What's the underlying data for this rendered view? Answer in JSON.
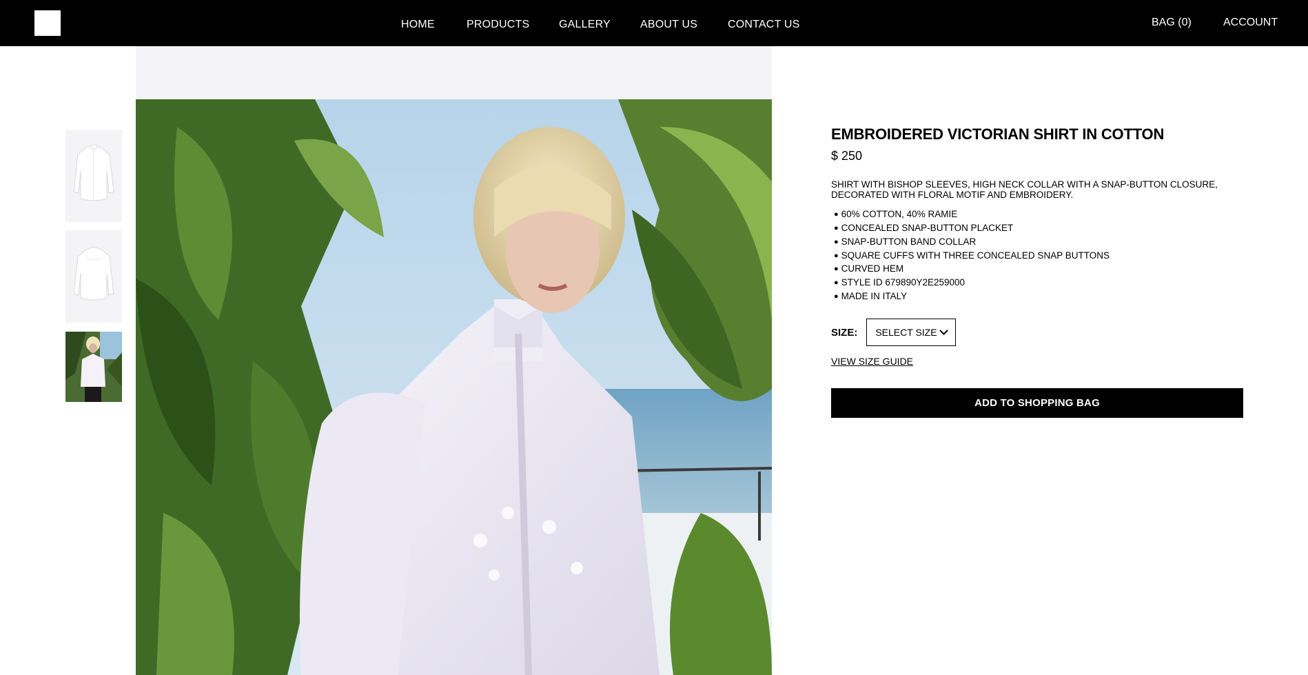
{
  "nav": {
    "links": [
      "HOME",
      "PRODUCTS",
      "GALLERY",
      "ABOUT US",
      "CONTACT US"
    ],
    "bag": "BAG (0)",
    "account": "ACCOUNT"
  },
  "product": {
    "title": "EMBROIDERED VICTORIAN SHIRT IN COTTON",
    "price": "$ 250",
    "description": "SHIRT WITH BISHOP SLEEVES, HIGH NECK COLLAR WITH A SNAP-BUTTON CLOSURE, DECORATED WITH FLORAL MOTIF AND EMBROIDERY.",
    "features": [
      "60% COTTON, 40% RAMIE",
      "CONCEALED SNAP-BUTTON PLACKET",
      "SNAP-BUTTON BAND COLLAR",
      "SQUARE CUFFS WITH THREE CONCEALED SNAP BUTTONS",
      "CURVED HEM",
      "STYLE ID 679890Y2E259000",
      "MADE IN ITALY"
    ],
    "size_label": "SIZE:",
    "size_select": "SELECT SIZE",
    "size_guide": "VIEW SIZE GUIDE",
    "add_button": "ADD TO SHOPPING BAG"
  },
  "colors": {
    "header_bg": "#000000",
    "image_bg": "#f4f4f6",
    "button_bg": "#000000"
  },
  "icons": {
    "logo": "logo-icon",
    "select": "chevron-down-icon"
  }
}
